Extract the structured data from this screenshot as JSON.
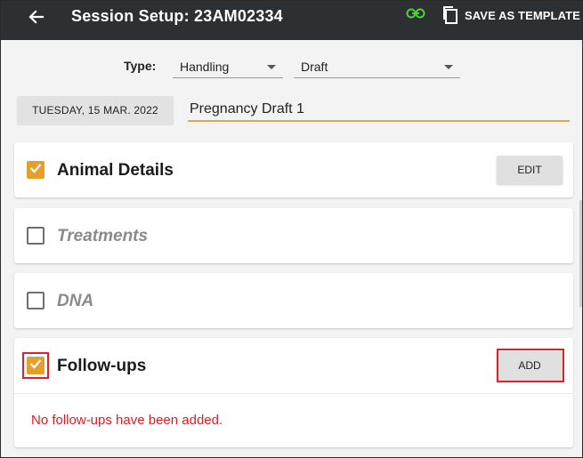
{
  "appbar": {
    "back_icon": "arrow-left-icon",
    "title": "Session Setup: 23AM02334",
    "link_icon": "link-icon",
    "link_icon_color": "#4cd137",
    "save_template_icon": "copy-icon",
    "save_template_label": "SAVE AS TEMPLATE",
    "background": "#2c3033"
  },
  "form": {
    "type_label": "Type:",
    "type_value": "Handling",
    "status_value": "Draft",
    "date": "TUESDAY, 15 MAR. 2022",
    "name_value": "Pregnancy Draft 1",
    "accent": "#e0a64a"
  },
  "sections": {
    "animal_details": {
      "title": "Animal Details",
      "checked": true,
      "button": "EDIT"
    },
    "treatments": {
      "title": "Treatments",
      "checked": false
    },
    "dna": {
      "title": "DNA",
      "checked": false
    },
    "followups": {
      "title": "Follow-ups",
      "checked": true,
      "button": "ADD",
      "empty_message": "No follow-ups have been added."
    }
  },
  "colors": {
    "checkbox_checked": "#e3a02d",
    "highlight": "#d9232b",
    "error_text": "#e21b22"
  }
}
